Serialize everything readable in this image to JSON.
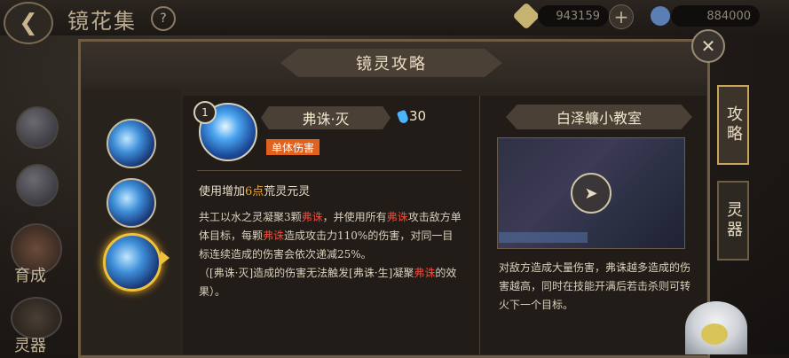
{
  "header": {
    "back_icon": "back-arrow-icon",
    "title": "镜花集",
    "help_label": "?",
    "currency1_value": "943159",
    "currency2_value": "884000",
    "plus_label": "+"
  },
  "left_nav": {
    "items": [
      {
        "label": "育成"
      },
      {
        "label": "灵器"
      }
    ]
  },
  "panel": {
    "title": "镜灵攻略",
    "close_label": "✕"
  },
  "skill": {
    "level": "1",
    "name": "弗诛·灭",
    "cost": "30",
    "tag": "单体伤害",
    "upgrade_prefix": "使用增加",
    "upgrade_highlight": "6点",
    "upgrade_suffix": "荒灵元灵",
    "desc": {
      "p1": "共工以水之灵凝聚3颗",
      "k1": "弗诛",
      "p2": "，并使用所有",
      "k2": "弗诛",
      "p3": "攻击敌方单体目标，每颗",
      "k3": "弗诛",
      "p4": "造成攻击力110%的伤害，对同一目标连续造成的伤害会依次递减25%。",
      "p5": "（[弗诛·灭]造成的伤害无法触发[弗诛·生]凝聚",
      "k4": "弗诛",
      "p6": "的效果）。"
    }
  },
  "tips": {
    "title": "白泽蠊小教室",
    "desc": "对敌方造成大量伤害，弗诛越多造成的伤害越高，同时在技能开满后若击杀则可转火下一个目标。"
  },
  "side_tabs": [
    {
      "label": "攻略"
    },
    {
      "label": "灵器"
    }
  ]
}
